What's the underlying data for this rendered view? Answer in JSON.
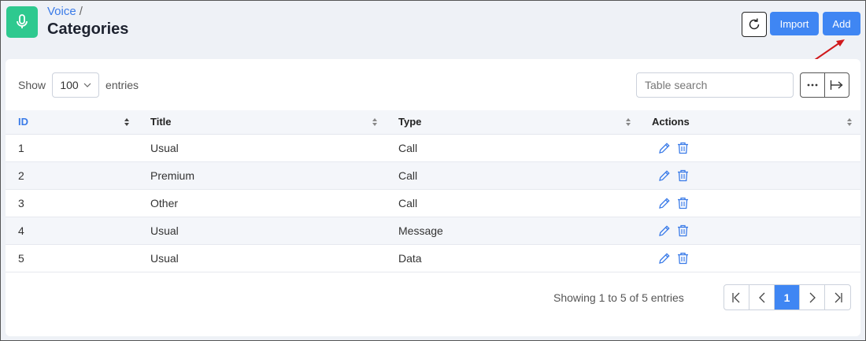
{
  "header": {
    "breadcrumb": "Voice",
    "breadcrumb_sep": "/",
    "title": "Categories",
    "app_icon": "microphone-icon",
    "import_label": "Import",
    "add_label": "Add"
  },
  "controls": {
    "show_label": "Show",
    "entries_label": "entries",
    "page_length": "100",
    "search_placeholder": "Table search"
  },
  "table": {
    "columns": [
      "ID",
      "Title",
      "Type",
      "Actions"
    ],
    "rows": [
      {
        "id": "1",
        "title": "Usual",
        "type": "Call"
      },
      {
        "id": "2",
        "title": "Premium",
        "type": "Call"
      },
      {
        "id": "3",
        "title": "Other",
        "type": "Call"
      },
      {
        "id": "4",
        "title": "Usual",
        "type": "Message"
      },
      {
        "id": "5",
        "title": "Usual",
        "type": "Data"
      }
    ]
  },
  "footer": {
    "info": "Showing 1 to 5 of 5 entries",
    "current_page": "1"
  },
  "colors": {
    "accent": "#3f86f3",
    "app_icon_bg": "#2ec98f",
    "annotation_arrow": "#d0191c"
  }
}
